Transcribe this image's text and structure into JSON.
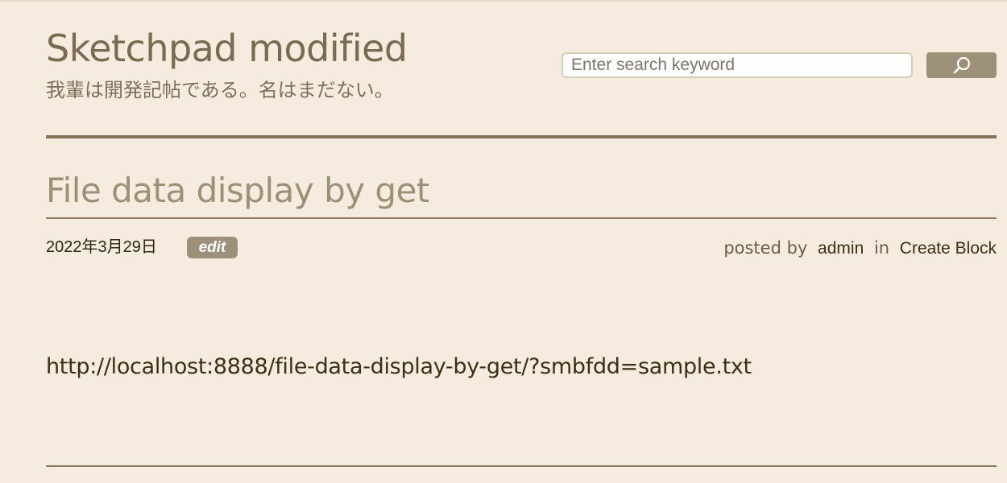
{
  "header": {
    "site_title": "Sketchpad modified",
    "site_description": "我輩は開発記帖である。名はまだない。"
  },
  "search": {
    "placeholder": "Enter search keyword",
    "button_icon": "search-icon"
  },
  "post": {
    "title": "File data display by get",
    "date": "2022年3月29日",
    "edit_label": "edit",
    "posted_by_label": "posted by",
    "author": "admin",
    "in_label": "in",
    "category": "Create Block",
    "content": "http://localhost:8888/file-data-display-by-get/?smbfdd=sample.txt"
  },
  "colors": {
    "background": "#f5ebdf",
    "title": "#7a6a50",
    "post_title": "#9e9074",
    "accent_button": "#9d9078",
    "rule": "#857659",
    "text": "#3e2f12"
  }
}
